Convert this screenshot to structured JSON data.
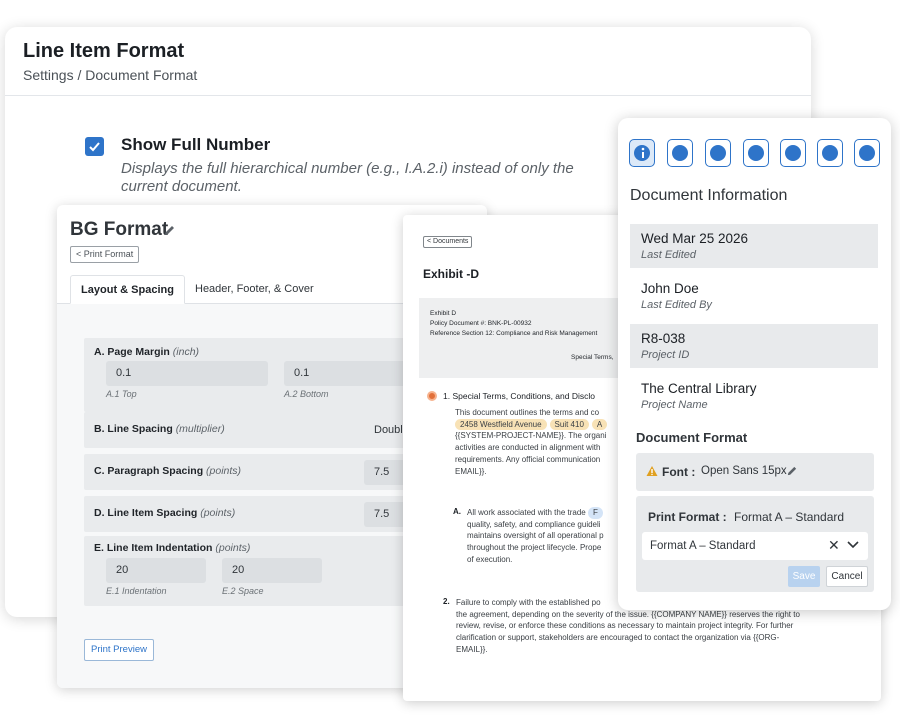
{
  "back": {
    "title": "Line Item Format",
    "breadcrumb": "Settings  /  Document Format",
    "show_full_number": {
      "label": "Show Full Number",
      "checked": true,
      "description": "Displays the full hierarchical number (e.g., I.A.2.i) instead of only the current document."
    }
  },
  "bg_format": {
    "title": "BG Format",
    "print_format_button": "< Print Format",
    "tabs": [
      "Layout & Spacing",
      "Header, Footer, & Cover"
    ],
    "page_margin": {
      "label": "A. Page Margin",
      "unit": "(inch)",
      "top": "0.1",
      "bottom": "0.1",
      "top_hint": "A.1 Top",
      "bottom_hint": "A.2 Bottom"
    },
    "line_spacing": {
      "label": "B. Line Spacing",
      "unit": "(multiplier)",
      "value": "Doubl"
    },
    "paragraph_spacing": {
      "label": "C. Paragraph Spacing",
      "unit": "(points)",
      "value": "7.5"
    },
    "line_item_spacing": {
      "label": "D. Line Item Spacing",
      "unit": "(points)",
      "value": "7.5"
    },
    "indentation": {
      "label": "E. Line Item Indentation",
      "unit": "(points)",
      "indent": "20",
      "space": "20",
      "indent_hint": "E.1 Indentation",
      "space_hint": "E.2 Space"
    },
    "print_preview_button": "Print Preview"
  },
  "doc": {
    "back_button": "< Documents",
    "title": "Exhibit -D",
    "meta": [
      "Exhibit D",
      "Policy Document #: BNK-PL-00932",
      "Reference Section 12: Compliance and Risk Management"
    ],
    "special_terms": "Special Terms,",
    "item1": {
      "num": "1.",
      "title": "Special Terms, Conditions, and Disclo"
    },
    "para1_lines": [
      "This document outlines the terms and co",
      "{{SYSTEM-PROJECT-NAME}}. The organi",
      "activities are conducted in alignment with",
      "requirements. Any official communication",
      "EMAIL}}."
    ],
    "tags": [
      "2458 Westfield Avenue",
      "Suit 410",
      "A"
    ],
    "itemA": {
      "num": "A.",
      "lines": [
        "All work associated with the trade",
        "quality, safety, and compliance guideli",
        "maintains oversight of all operational p",
        "throughout the project lifecycle. Prope",
        "of execution."
      ],
      "tag": "F"
    },
    "item2": {
      "num": "2.",
      "lines": [
        "Failure to comply with the established po",
        "the agreement, depending on the severity of the issue. {{COMPANY NAME}} reserves the right to",
        "review, revise, or enforce these conditions as necessary to maintain project integrity. For further",
        "clarification or support, stakeholders are encouraged to contact the organization via {{ORG-",
        "EMAIL}}."
      ]
    }
  },
  "info": {
    "icons": [
      "info-icon",
      "key-icon",
      "id-badge-icon",
      "clipboard-icon",
      "trash-icon",
      "chat-icon",
      "compass-icon"
    ],
    "heading": "Document Information",
    "rows": [
      {
        "main": "Wed Mar 25 2026",
        "sub": "Last Edited"
      },
      {
        "main": "John Doe",
        "sub": "Last Edited By"
      },
      {
        "main": "R8-038",
        "sub": "Project ID"
      },
      {
        "main": "The Central Library",
        "sub": "Project Name"
      }
    ],
    "doc_format_heading": "Document Format",
    "font_label": "Font :",
    "font_value": "Open Sans 15px",
    "print_format_label": "Print Format :",
    "print_format_value": "Format A – Standard",
    "select_value": "Format A – Standard",
    "save": "Save",
    "cancel": "Cancel"
  },
  "colors": {
    "accent": "#2e74c9",
    "warning": "#e0a020",
    "orange_dot": "#e2703a"
  }
}
